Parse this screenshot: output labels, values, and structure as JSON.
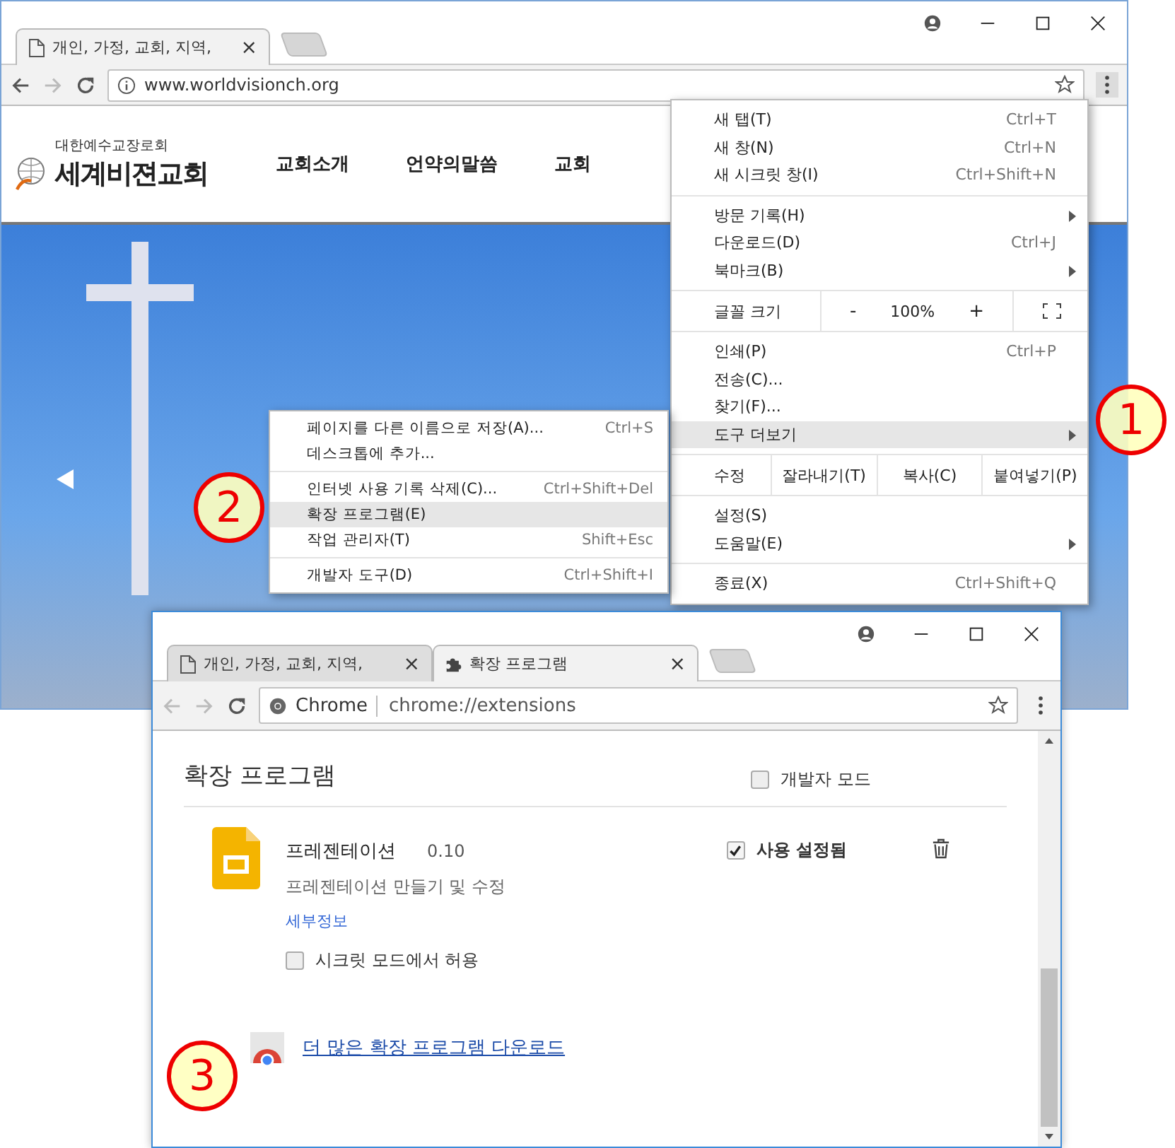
{
  "back_window": {
    "tabs": [
      {
        "title": "개인, 가정, 교회, 지역,",
        "close": "×",
        "selected": true
      }
    ],
    "address": "www.worldvisionch.org",
    "site": {
      "logo_sub": "대한예수교장로회",
      "logo": "세계비젼교회",
      "nav": [
        "교회소개",
        "언약의말씀",
        "교회"
      ]
    }
  },
  "main_menu": {
    "sections": [
      [
        {
          "kind": "item",
          "label": "새 탭(T)",
          "shortcut": "Ctrl+T",
          "submenu": false,
          "selected": false
        },
        {
          "kind": "item",
          "label": "새 창(N)",
          "shortcut": "Ctrl+N",
          "submenu": false,
          "selected": false
        },
        {
          "kind": "item",
          "label": "새 시크릿 창(I)",
          "shortcut": "Ctrl+Shift+N",
          "submenu": false,
          "selected": false
        }
      ],
      [
        {
          "kind": "item",
          "label": "방문 기록(H)",
          "submenu": true,
          "selected": false
        },
        {
          "kind": "item",
          "label": "다운로드(D)",
          "shortcut": "Ctrl+J",
          "submenu": false,
          "selected": false
        },
        {
          "kind": "item",
          "label": "북마크(B)",
          "submenu": true,
          "selected": false
        }
      ],
      [
        {
          "kind": "zoom",
          "label": "글꼴 크기",
          "minus": "-",
          "value": "100%",
          "plus": "+"
        }
      ],
      [
        {
          "kind": "item",
          "label": "인쇄(P)",
          "shortcut": "Ctrl+P",
          "submenu": false,
          "selected": false
        },
        {
          "kind": "item",
          "label": "전송(C)...",
          "submenu": false,
          "selected": false
        },
        {
          "kind": "item",
          "label": "찾기(F)...",
          "submenu": false,
          "selected": false
        },
        {
          "kind": "item",
          "label": "도구 더보기",
          "submenu": true,
          "selected": true
        }
      ],
      [
        {
          "kind": "edit",
          "label": "수정",
          "buttons": [
            "잘라내기(T)",
            "복사(C)",
            "붙여넣기(P)"
          ]
        }
      ],
      [
        {
          "kind": "item",
          "label": "설정(S)",
          "submenu": false,
          "selected": false
        },
        {
          "kind": "item",
          "label": "도움말(E)",
          "submenu": true,
          "selected": false
        }
      ],
      [
        {
          "kind": "item",
          "label": "종료(X)",
          "shortcut": "Ctrl+Shift+Q",
          "submenu": false,
          "selected": false
        }
      ]
    ]
  },
  "sub_menu": {
    "sections": [
      [
        {
          "label": "페이지를 다른 이름으로 저장(A)...",
          "shortcut": "Ctrl+S",
          "selected": false
        },
        {
          "label": "데스크톱에 추가...",
          "selected": false
        }
      ],
      [
        {
          "label": "인터넷 사용 기록 삭제(C)...",
          "shortcut": "Ctrl+Shift+Del",
          "selected": false
        },
        {
          "label": "확장 프로그램(E)",
          "selected": true
        },
        {
          "label": "작업 관리자(T)",
          "shortcut": "Shift+Esc",
          "selected": false
        }
      ],
      [
        {
          "label": "개발자 도구(D)",
          "shortcut": "Ctrl+Shift+I",
          "selected": false
        }
      ]
    ]
  },
  "front_window": {
    "tabs": [
      {
        "kind": "page",
        "title": "개인, 가정, 교회, 지역,",
        "close": "×",
        "selected": false
      },
      {
        "kind": "extensions",
        "title": "확장 프로그램",
        "close": "×",
        "selected": true
      }
    ],
    "address": {
      "chip": "Chrome",
      "url": "chrome://extensions"
    },
    "page": {
      "title": "확장 프로그램",
      "developer_mode": {
        "label": "개발자 모드",
        "checked": false
      },
      "extensions": [
        {
          "name": "프레젠테이션",
          "version": "0.10",
          "description": "프레젠테이션 만들기 및 수정",
          "details_link": "세부정보",
          "incognito": {
            "label": "시크릿 모드에서 허용",
            "checked": false
          },
          "enabled": {
            "label": "사용 설정됨",
            "checked": true
          }
        }
      ],
      "store_link": "더 많은 확장 프로그램 다운로드"
    }
  },
  "callouts": [
    "1",
    "2",
    "3"
  ]
}
